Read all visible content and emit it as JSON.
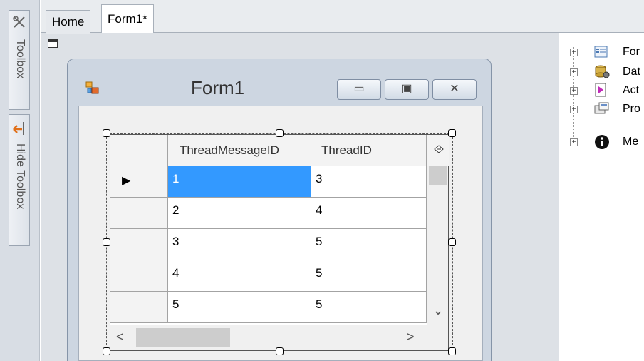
{
  "toolbox": {
    "toolbox_label": "Toolbox",
    "hide_toolbox_label": "Hide Toolbox"
  },
  "tabs": [
    {
      "label": "Home"
    },
    {
      "label": "Form1*"
    }
  ],
  "form": {
    "title": "Form1",
    "minimize": "▭",
    "maximize": "▣",
    "close": "✕"
  },
  "grid": {
    "columns": [
      "ThreadMessageID",
      "ThreadID"
    ],
    "rows": [
      {
        "ThreadMessageID": "1",
        "ThreadID": "3"
      },
      {
        "ThreadMessageID": "2",
        "ThreadID": "4"
      },
      {
        "ThreadMessageID": "3",
        "ThreadID": "5"
      },
      {
        "ThreadMessageID": "4",
        "ThreadID": "5"
      },
      {
        "ThreadMessageID": "5",
        "ThreadID": "5"
      }
    ],
    "current_row_indicator": "▶",
    "scroll_down": "⌄",
    "scroll_left": "<",
    "scroll_right": ">"
  },
  "explorer": {
    "items": [
      {
        "label": "For",
        "icon": "form-icon"
      },
      {
        "label": "Dat",
        "icon": "database-icon"
      },
      {
        "label": "Act",
        "icon": "action-icon"
      },
      {
        "label": "Pro",
        "icon": "property-icon"
      },
      {
        "label": "Me",
        "icon": "info-icon"
      }
    ]
  },
  "colors": {
    "selection": "#3399ff",
    "designer_bg": "#dde1e6"
  }
}
